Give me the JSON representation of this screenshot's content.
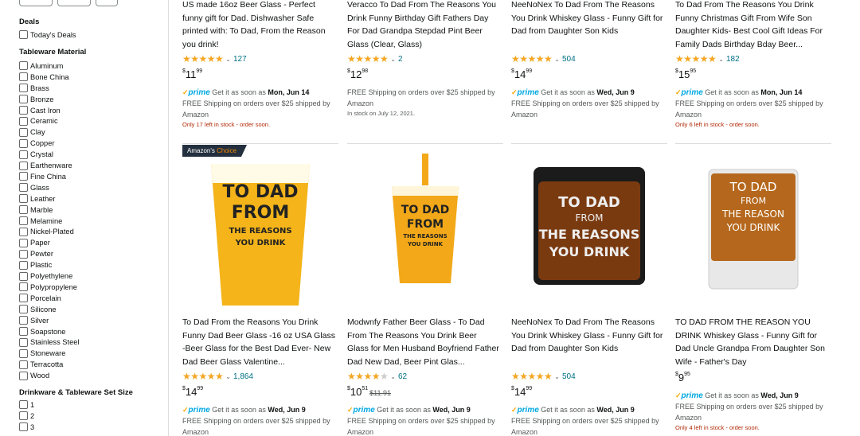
{
  "sidebar": {
    "deals_heading": "Deals",
    "todays_deals": "Today's Deals",
    "material_heading": "Tableware Material",
    "materials": [
      "Aluminum",
      "Bone China",
      "Brass",
      "Bronze",
      "Cast Iron",
      "Ceramic",
      "Clay",
      "Copper",
      "Crystal",
      "Earthenware",
      "Fine China",
      "Glass",
      "Leather",
      "Marble",
      "Melamine",
      "Nickel-Plated",
      "Paper",
      "Pewter",
      "Plastic",
      "Polyethylene",
      "Polypropylene",
      "Porcelain",
      "Silicone",
      "Silver",
      "Soapstone",
      "Stainless Steel",
      "Stoneware",
      "Terracotta",
      "Wood"
    ],
    "set_size_heading": "Drinkware & Tableware Set Size",
    "set_sizes": [
      "1",
      "2",
      "3"
    ]
  },
  "prime_label": "prime",
  "prime_check": "✓",
  "products": [
    {
      "title": "US made 16oz Beer Glass - Perfect funny gift for Dad. Dishwasher Safe printed with: To Dad, From the Reason you drink!",
      "stars": "★★★★★",
      "reviews": "127",
      "price_sym": "$",
      "price_whole": "11",
      "price_frac": "99",
      "prime": true,
      "delivery_prefix": "Get it as soon as",
      "delivery_date": "Mon, Jun 14",
      "shipping": "FREE Shipping on orders over $25 shipped by Amazon",
      "stock": "Only 17 left in stock - order soon."
    },
    {
      "title": "Veracco To Dad From The Reasons You Drink Funny Birthday Gift Fathers Day For Dad Grandpa Stepdad Pint Beer Glass (Clear, Glass)",
      "stars": "★★★★★",
      "reviews": "2",
      "price_sym": "$",
      "price_whole": "12",
      "price_frac": "98",
      "prime": false,
      "shipping": "FREE Shipping on orders over $25 shipped by Amazon",
      "stock": "In stock on July 12, 2021."
    },
    {
      "title": "NeeNoNex To Dad From The Reasons You Drink Whiskey Glass - Funny Gift for Dad from Daughter Son Kids",
      "stars": "★★★★★",
      "reviews": "504",
      "price_sym": "$",
      "price_whole": "14",
      "price_frac": "99",
      "prime": true,
      "delivery_prefix": "Get it as soon as",
      "delivery_date": "Wed, Jun 9",
      "shipping": "FREE Shipping on orders over $25 shipped by Amazon",
      "stock": ""
    },
    {
      "title": "To Dad From The Reasons You Drink Funny Christmas Gift From Wife Son Daughter Kids- Best Cool Gift Ideas For Family Dads Birthday Bday Beer...",
      "stars": "★★★★★",
      "reviews": "182",
      "price_sym": "$",
      "price_whole": "15",
      "price_frac": "95",
      "prime": true,
      "delivery_prefix": "Get it as soon as",
      "delivery_date": "Mon, Jun 14",
      "shipping": "FREE Shipping on orders over $25 shipped by Amazon",
      "stock": "Only 6 left in stock - order soon."
    },
    {
      "badge_prefix": "Amazon's",
      "badge_choice": "Choice",
      "img_text": [
        "TO DAD",
        "FROM",
        "THE REASONS",
        "YOU DRINK"
      ],
      "title": "To Dad From the Reasons You Drink Funny Dad Beer Glass -16 oz USA Glass -Beer Glass for the Best Dad Ever- New Dad Beer Glass Valentine...",
      "stars": "★★★★★",
      "reviews": "1,864",
      "price_sym": "$",
      "price_whole": "14",
      "price_frac": "99",
      "prime": true,
      "delivery_prefix": "Get it as soon as",
      "delivery_date": "Wed, Jun 9",
      "shipping": "FREE Shipping on orders over $25 shipped by Amazon",
      "stock": ""
    },
    {
      "img_text": [
        "TO DAD",
        "FROM",
        "THE REASONS",
        "YOU DRINK"
      ],
      "title": "Modwnfy Father Beer Glass - To Dad From The Reasons You Drink Beer Glass for Men Husband Boyfriend Father Dad New Dad, Beer Pint Glas...",
      "stars": "★★★★",
      "stars_dim": "★",
      "reviews": "62",
      "price_sym": "$",
      "price_whole": "10",
      "price_frac": "51",
      "list_price": "$11.91",
      "prime": true,
      "delivery_prefix": "Get it as soon as",
      "delivery_date": "Wed, Jun 9",
      "shipping": "FREE Shipping on orders over $25 shipped by Amazon",
      "stock": ""
    },
    {
      "img_text": [
        "TO DAD",
        "FROM",
        "THE REASONS",
        "YOU DRINK"
      ],
      "title": "NeeNoNex To Dad From The Reasons You Drink Whiskey Glass - Funny Gift for Dad from Daughter Son Kids",
      "stars": "★★★★★",
      "reviews": "504",
      "price_sym": "$",
      "price_whole": "14",
      "price_frac": "99",
      "prime": true,
      "delivery_prefix": "Get it as soon as",
      "delivery_date": "Wed, Jun 9",
      "shipping": "FREE Shipping on orders over $25 shipped by Amazon",
      "stock": ""
    },
    {
      "img_text": [
        "TO DAD",
        "FROM",
        "THE REASON",
        "YOU DRINK"
      ],
      "title": "TO DAD FROM THE REASON YOU DRINK Whiskey Glass - Funny Gift for Dad Uncle Grandpa From Daughter Son Wife - Father's Day",
      "price_sym": "$",
      "price_whole": "9",
      "price_frac": "95",
      "prime": true,
      "delivery_prefix": "Get it as soon as",
      "delivery_date": "Wed, Jun 9",
      "shipping": "FREE Shipping on orders over $25 shipped by Amazon",
      "stock": "Only 4 left in stock - order soon."
    }
  ],
  "colors": {
    "star": "#f4a622",
    "link": "#007185",
    "prime": "#00a8e1",
    "stock_warning": "#b12704",
    "badge_bg": "#232f3e",
    "badge_accent": "#f08804"
  }
}
